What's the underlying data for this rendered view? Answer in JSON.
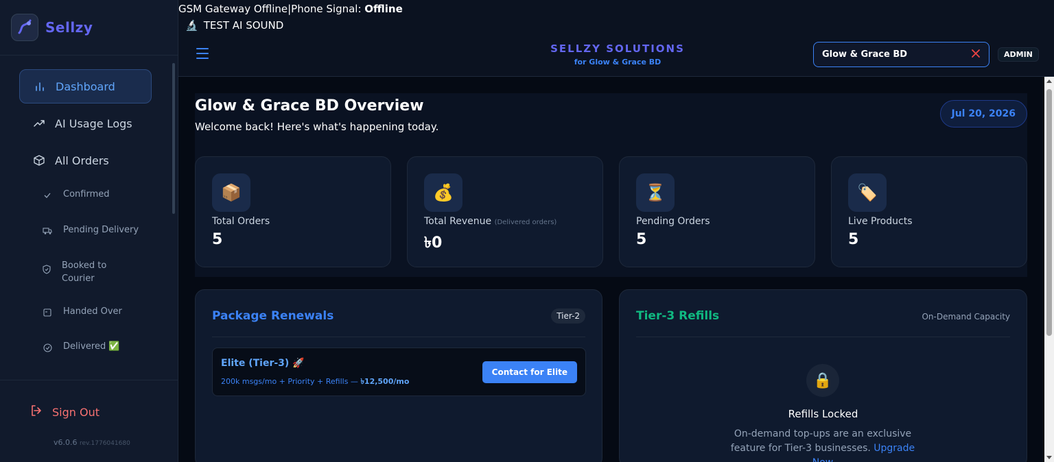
{
  "app": {
    "name": "Sellzy"
  },
  "status_bar": {
    "prefix": "GSM Gateway Offline|Phone Signal: ",
    "signal": "Offline",
    "test_sound": "TEST AI SOUND"
  },
  "header": {
    "brand_title": "SELLZY SOLUTIONS",
    "brand_sub": "for Glow & Grace BD",
    "tenant": "Glow & Grace BD",
    "role": "ADMIN"
  },
  "sidebar": {
    "items": [
      {
        "label": "Dashboard",
        "icon": "bar-chart-icon"
      },
      {
        "label": "AI Usage Logs",
        "icon": "trend-icon"
      },
      {
        "label": "All Orders",
        "icon": "box-icon"
      }
    ],
    "sub_items": [
      {
        "label": "Confirmed",
        "icon": "check-icon"
      },
      {
        "label": "Pending Delivery",
        "icon": "truck-icon"
      },
      {
        "label": "Booked to Courier",
        "icon": "shield-icon"
      },
      {
        "label": "Handed Over",
        "icon": "handover-icon"
      },
      {
        "label": "Delivered ✅",
        "icon": "check-circle-icon"
      }
    ],
    "sign_out": "Sign Out",
    "version": "v6.0.6",
    "revision": "rev.1776041680"
  },
  "overview": {
    "title": "Glow & Grace BD Overview",
    "subtitle": "Welcome back! Here's what's happening today.",
    "date": "Jul 20, 2026"
  },
  "stats": [
    {
      "label": "Total Orders",
      "note": "",
      "value": "5",
      "emoji": "📦"
    },
    {
      "label": "Total Revenue",
      "note": "(Delivered orders)",
      "value": "৳0",
      "emoji": "💰"
    },
    {
      "label": "Pending Orders",
      "note": "",
      "value": "5",
      "emoji": "⏳"
    },
    {
      "label": "Live Products",
      "note": "",
      "value": "5",
      "emoji": "🏷️"
    }
  ],
  "renewals": {
    "title": "Package Renewals",
    "tier": "Tier-2",
    "plan_name": "Elite (Tier-3) 🚀",
    "plan_desc": "200k msgs/mo + Priority + Refills — ",
    "plan_price": "৳12,500/mo",
    "cta": "Contact for Elite"
  },
  "refills": {
    "title": "Tier-3 Refills",
    "capacity": "On-Demand Capacity",
    "lock_emoji": "🔒",
    "locked_title": "Refills Locked",
    "locked_desc": "On-demand top-ups are an exclusive feature for Tier-3 businesses. ",
    "upgrade": "Upgrade Now"
  },
  "colors": {
    "accent": "#3b82f6",
    "brand": "#6366f1",
    "green": "#10b981",
    "danger": "#f87171"
  }
}
